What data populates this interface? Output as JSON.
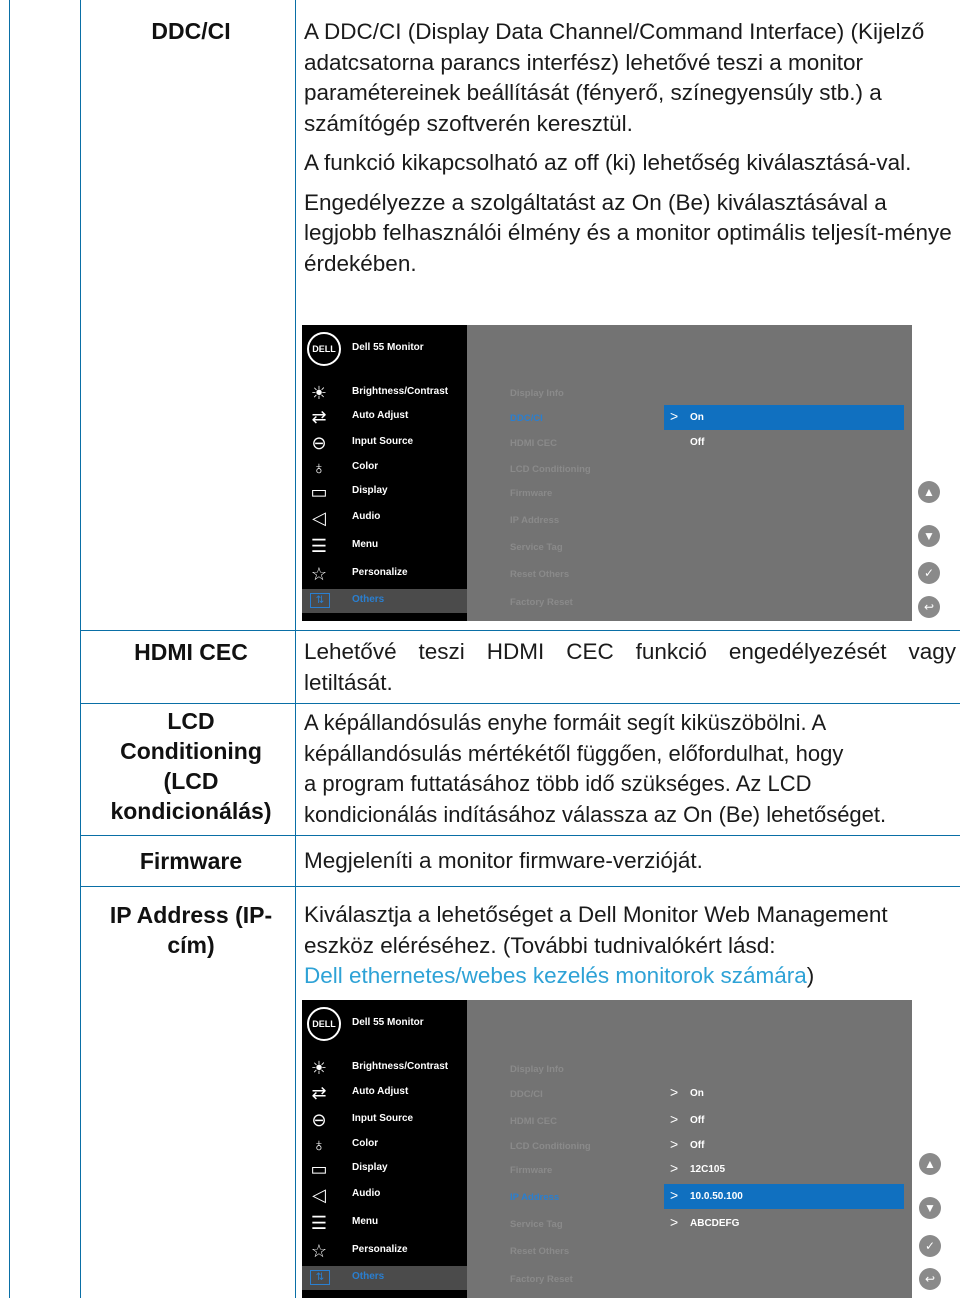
{
  "rows": [
    {
      "term": "DDC/CI",
      "paragraphs": [
        "A DDC/CI (Display Data Channel/Command Interface) (Kijelző adatcsatorna parancs interfész) lehetővé teszi a monitor paramétereinek beállítását (fényerő, színegyensúly stb.) a számítógép szoftverén keresztül.",
        "A funkció kikapcsolható az off (ki) lehetőség kiválasztásá-val.",
        "Engedélyezze a szolgáltatást az On (Be) kiválasztásával a legjobb felhasználói élmény és a monitor optimális teljesít-ménye érdekében."
      ]
    },
    {
      "term": "HDMI CEC",
      "paragraphs": [
        "Lehetővé teszi HDMI CEC funkció engedélyezését vagy letiltását."
      ]
    },
    {
      "term_lines": [
        "LCD",
        "Conditioning",
        "(LCD",
        "kondicionálás)"
      ],
      "lines": [
        "A képállandósulás enyhe formáit segít kiküszöbölni. A",
        "képállandósulás mértékétől függően, előfordulhat, hogy",
        "a program futtatásához több idő szükséges. Az LCD",
        "kondicionálás indításához válassza az On (Be) lehetőséget."
      ]
    },
    {
      "term": "Firmware",
      "paragraphs": [
        "Megjeleníti a monitor firmware-verzióját."
      ]
    },
    {
      "term_lines": [
        "IP Address (IP-",
        "cím)"
      ],
      "lines": [
        "Kiválasztja a lehetőséget a Dell Monitor Web Management",
        "eszköz eléréséhez. (További tudnivalókért lásd:"
      ],
      "link": "Dell ethernetes/webes kezelés monitorok számára",
      "after_link": ")"
    }
  ],
  "osd": {
    "logo": "DELL",
    "model": "Dell 55 Monitor",
    "menu": [
      {
        "label": "Brightness/Contrast",
        "icon": "brightness-icon"
      },
      {
        "label": "Auto Adjust",
        "icon": "auto-adjust-icon"
      },
      {
        "label": "Input Source",
        "icon": "input-source-icon"
      },
      {
        "label": "Color",
        "icon": "color-icon"
      },
      {
        "label": "Display",
        "icon": "display-icon"
      },
      {
        "label": "Audio",
        "icon": "audio-icon"
      },
      {
        "label": "Menu",
        "icon": "menu-icon"
      },
      {
        "label": "Personalize",
        "icon": "personalize-icon"
      },
      {
        "label": "Others",
        "icon": "others-icon"
      }
    ],
    "submenu": [
      "Display Info",
      "DDC/CI",
      "HDMI CEC",
      "LCD Conditioning",
      "Firmware",
      "IP Address",
      "Service Tag",
      "Reset Others",
      "Factory Reset"
    ],
    "osd1_values": [
      "On",
      "Off"
    ],
    "osd2_values": [
      "On",
      "Off",
      "Off",
      "12C105",
      "10.0.50.100",
      "ABCDEFG"
    ]
  },
  "colors": {
    "border": "#0a6fa6",
    "link": "#2ea2d6",
    "highlight": "#1070c0",
    "selected_text": "#2a7fd0"
  }
}
